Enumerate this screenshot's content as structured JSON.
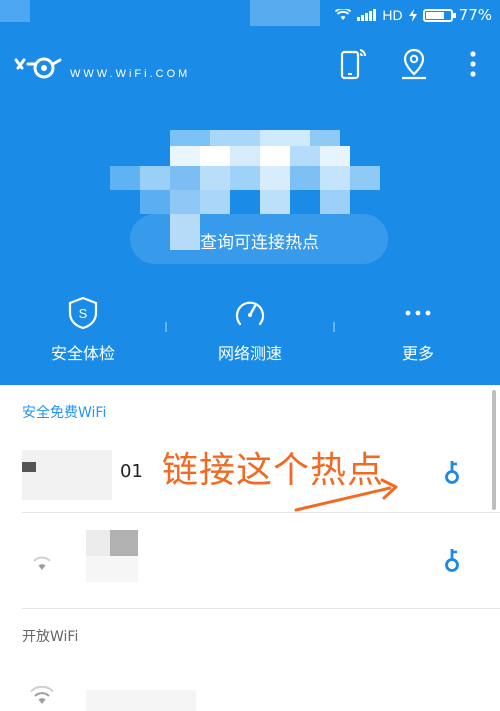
{
  "status_bar": {
    "network": "HD",
    "battery": "77%",
    "battery_level": 0.77
  },
  "app_bar": {
    "domain": "WWW.WiFi.COM",
    "icons": [
      "wifi-key-logo-icon",
      "phone-signal-icon",
      "location-pin-icon",
      "more-vertical-icon"
    ]
  },
  "hero": {
    "hotspot_label": "查询可连接热点"
  },
  "features": [
    {
      "label": "安全体检",
      "icon": "shield-s-icon"
    },
    {
      "label": "网络测速",
      "icon": "speedometer-icon"
    },
    {
      "label": "更多",
      "icon": "more-horizontal-icon"
    }
  ],
  "list": {
    "secure_section": "安全免费WiFi",
    "open_section": "开放WiFi",
    "item1_ssid_fragment": "01"
  },
  "annotation": {
    "text": "链接这个热点"
  },
  "colors": {
    "header_blue": "#1a8ce8",
    "accent_blue": "#2196f3",
    "annotation_orange": "#f26a21"
  }
}
